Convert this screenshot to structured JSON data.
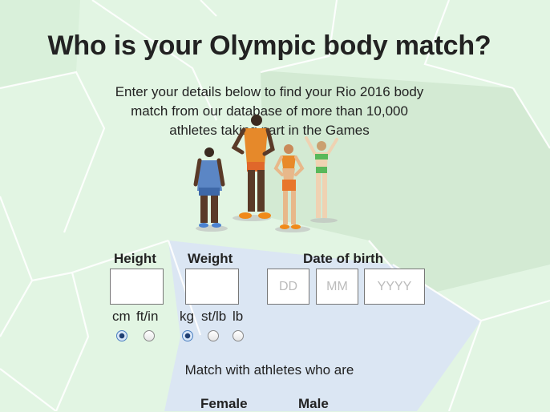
{
  "title": "Who is your Olympic body match?",
  "intro": {
    "line1": "Enter your details below to find your Rio 2016 body",
    "line2": "match from our database of more than 10,000",
    "line3": "athletes taking part in the Games"
  },
  "form": {
    "height_label": "Height",
    "weight_label": "Weight",
    "dob_label": "Date of birth",
    "height_value": "",
    "weight_value": "",
    "dob_day_placeholder": "DD",
    "dob_month_placeholder": "MM",
    "dob_year_placeholder": "YYYY",
    "height_units": [
      "cm",
      "ft/in"
    ],
    "height_selected": "cm",
    "weight_units": [
      "kg",
      "st/lb",
      "lb"
    ],
    "weight_selected": "kg"
  },
  "match": {
    "label": "Match with athletes who are",
    "female_label": "Female",
    "male_label": "Male"
  },
  "colors": {
    "background": "#e2f5e3",
    "accent_blue": "#4a7fc0"
  }
}
